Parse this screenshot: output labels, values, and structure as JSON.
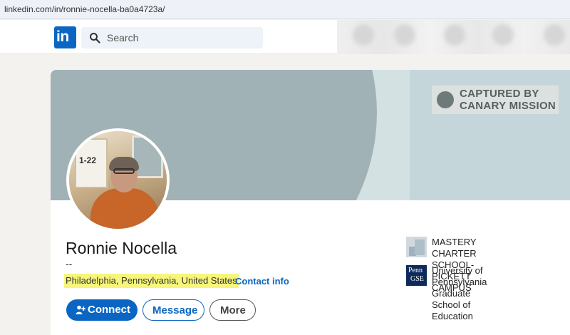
{
  "browser": {
    "url": "linkedin.com/in/ronnie-nocella-ba0a4723a/"
  },
  "nav": {
    "logo_text": "in",
    "search_placeholder": "Search",
    "brand_color": "#0a66c2"
  },
  "banner": {
    "watermark": [
      "CAPTURED BY",
      "CANARY MISSION"
    ]
  },
  "avatar": {
    "board_text": "1-22"
  },
  "profile": {
    "name": "Ronnie Nocella",
    "headline": "--",
    "location": "Philadelphia, Pennsylvania, United States",
    "separator": "·",
    "contact_info": "Contact info"
  },
  "actions": {
    "connect": "Connect",
    "message": "Message",
    "more": "More"
  },
  "experience": [
    {
      "lines": [
        "MASTERY CHARTER SCHOOL-",
        "PICKETT CAMPUS"
      ]
    },
    {
      "logo_text": [
        "Penn",
        "GSE"
      ],
      "lines": [
        "University of Pennsylvania",
        "Graduate School of Education"
      ]
    }
  ]
}
